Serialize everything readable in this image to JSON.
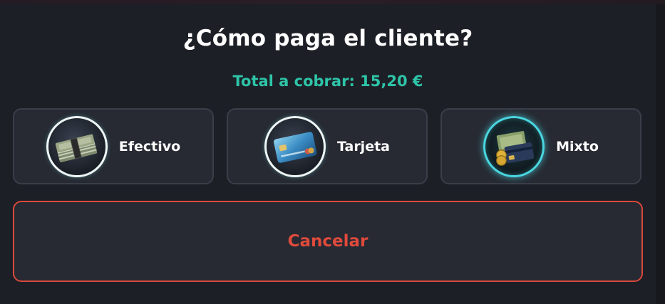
{
  "dialog": {
    "title": "¿Cómo paga el cliente?",
    "total_text": "Total a cobrar: 15,20 €"
  },
  "methods": [
    {
      "label": "Efectivo",
      "icon": "cash-bundle-icon"
    },
    {
      "label": "Tarjeta",
      "icon": "credit-card-icon"
    },
    {
      "label": "Mixto",
      "icon": "cash-and-card-icon"
    }
  ],
  "cancel_label": "Cancelar",
  "colors": {
    "background": "#1d1f26",
    "card": "#272a33",
    "card_border": "#3a3e49",
    "accent_total": "#2ec4a8",
    "cancel": "#e04a3c"
  }
}
